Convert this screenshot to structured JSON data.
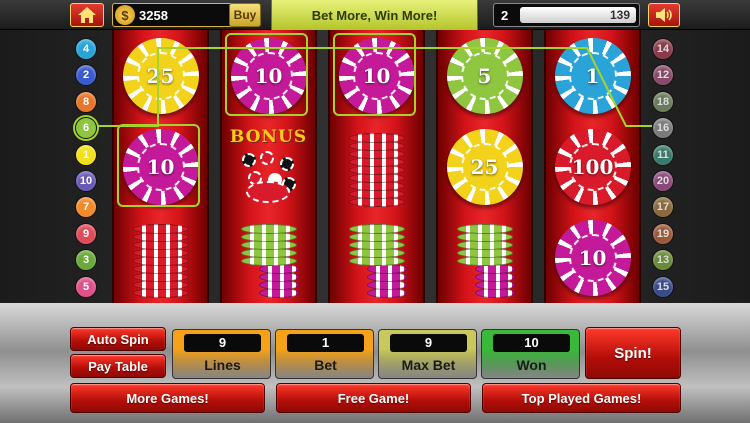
{
  "topbar": {
    "coin_symbol": "$",
    "coins": "3258",
    "buy_label": "Buy",
    "banner": "Bet More, Win More!",
    "level": "2",
    "xp": "139",
    "xp_fill": 1.0
  },
  "paylines_left": [
    {
      "n": "4",
      "color": "#2aa4d8"
    },
    {
      "n": "2",
      "color": "#3a5ad0"
    },
    {
      "n": "8",
      "color": "#e8762a"
    },
    {
      "n": "6",
      "color": "#8ec63f"
    },
    {
      "n": "1",
      "color": "#f2e01a"
    },
    {
      "n": "10",
      "color": "#6a5ab8"
    },
    {
      "n": "7",
      "color": "#f08a2a"
    },
    {
      "n": "9",
      "color": "#e04a5a"
    },
    {
      "n": "3",
      "color": "#6aa83a"
    },
    {
      "n": "5",
      "color": "#e0508a"
    }
  ],
  "paylines_right": [
    {
      "n": "14",
      "color": "#8a3a4a"
    },
    {
      "n": "12",
      "color": "#8a4a6a"
    },
    {
      "n": "18",
      "color": "#6a7a5a"
    },
    {
      "n": "16",
      "color": "#7a7a7a"
    },
    {
      "n": "11",
      "color": "#3a7a6a"
    },
    {
      "n": "20",
      "color": "#8a4a7a"
    },
    {
      "n": "17",
      "color": "#8a6a3a"
    },
    {
      "n": "19",
      "color": "#9a5a3a"
    },
    {
      "n": "13",
      "color": "#6a8a3a"
    },
    {
      "n": "15",
      "color": "#3a4a8a"
    }
  ],
  "reels": [
    [
      {
        "kind": "chip",
        "value": "25",
        "color": "#f2d21a"
      },
      {
        "kind": "chip",
        "value": "10",
        "color": "#c41a9a"
      },
      {
        "kind": "stack",
        "color": "#d81a2a"
      }
    ],
    [
      {
        "kind": "chip",
        "value": "10",
        "color": "#c41a9a"
      },
      {
        "kind": "bonus",
        "text": "BONUS"
      },
      {
        "kind": "stack2",
        "color": "#8ec63f",
        "color2": "#c41a9a"
      }
    ],
    [
      {
        "kind": "chip",
        "value": "10",
        "color": "#c41a9a"
      },
      {
        "kind": "stack",
        "color": "#d81a2a"
      },
      {
        "kind": "stack2",
        "color": "#8ec63f",
        "color2": "#c41a9a"
      }
    ],
    [
      {
        "kind": "chip",
        "value": "5",
        "color": "#8ec63f"
      },
      {
        "kind": "chip",
        "value": "25",
        "color": "#f2d21a"
      },
      {
        "kind": "stack2",
        "color": "#8ec63f",
        "color2": "#c41a9a"
      }
    ],
    [
      {
        "kind": "chip",
        "value": "1",
        "color": "#2aa4d8"
      },
      {
        "kind": "chip",
        "value": "100",
        "color": "#d81a2a"
      },
      {
        "kind": "chip",
        "value": "10",
        "color": "#c41a9a"
      }
    ]
  ],
  "controls": {
    "auto_spin": "Auto Spin",
    "pay_table": "Pay Table",
    "lines_value": "9",
    "lines_label": "Lines",
    "bet_value": "1",
    "bet_label": "Bet",
    "maxbet_value": "9",
    "maxbet_label": "Max Bet",
    "won_value": "10",
    "won_label": "Won",
    "spin": "Spin!",
    "more_games": "More Games!",
    "free_game": "Free Game!",
    "top_played": "Top Played Games!"
  },
  "colors": {
    "lines_box": "#f5a21a",
    "bet_box": "#f5a21a",
    "maxbet_box": "#c9c85a",
    "won_box": "#3ab83a",
    "win_highlight": "#a4d42c"
  }
}
